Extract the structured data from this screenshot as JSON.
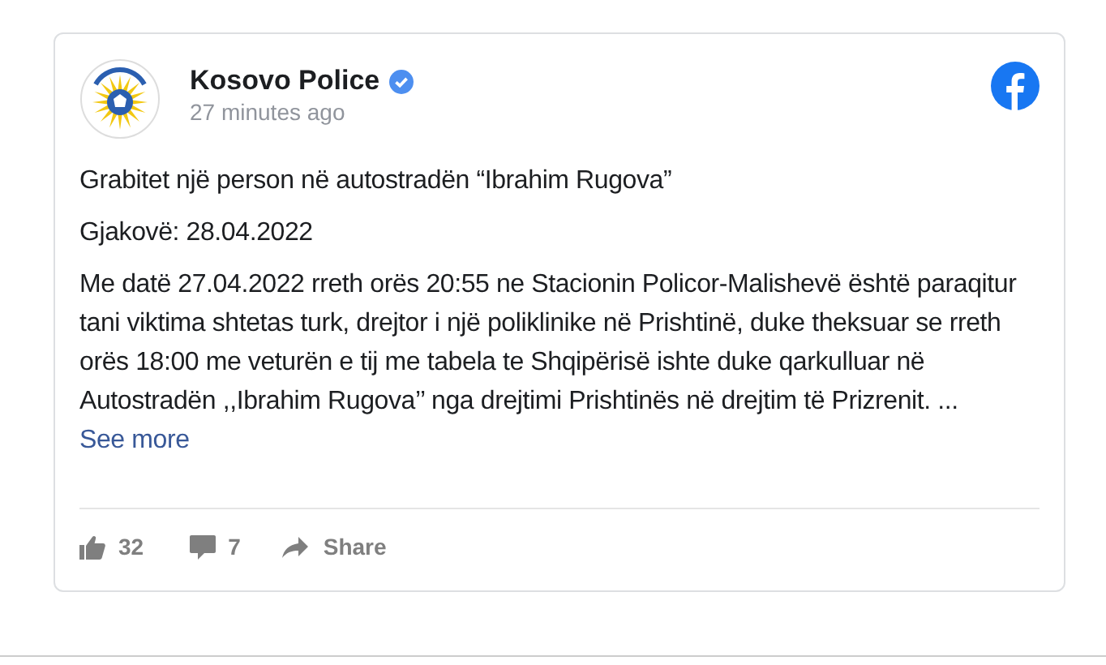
{
  "post": {
    "author": "Kosovo Police",
    "verified": true,
    "time": "27 minutes ago",
    "paragraphs": [
      "Grabitet një person në autostradën “Ibrahim Rugova”",
      "Gjakovë: 28.04.2022",
      "Me datë 27.04.2022 rreth orës 20:55 ne Stacionin Policor-Malishevë është paraqitur tani viktima shtetas turk, drejtor i një poliklinike në Prishtinë, duke theksuar se rreth orës 18:00 me veturën e tij me tabela te Shqipërisë ishte duke qarkulluar në Autostradën ,,Ibrahim Rugova’’ nga drejtimi Prishtinës në drejtim të Prizrenit. ..."
    ],
    "see_more": "See more",
    "likes": "32",
    "comments": "7",
    "share": "Share"
  }
}
